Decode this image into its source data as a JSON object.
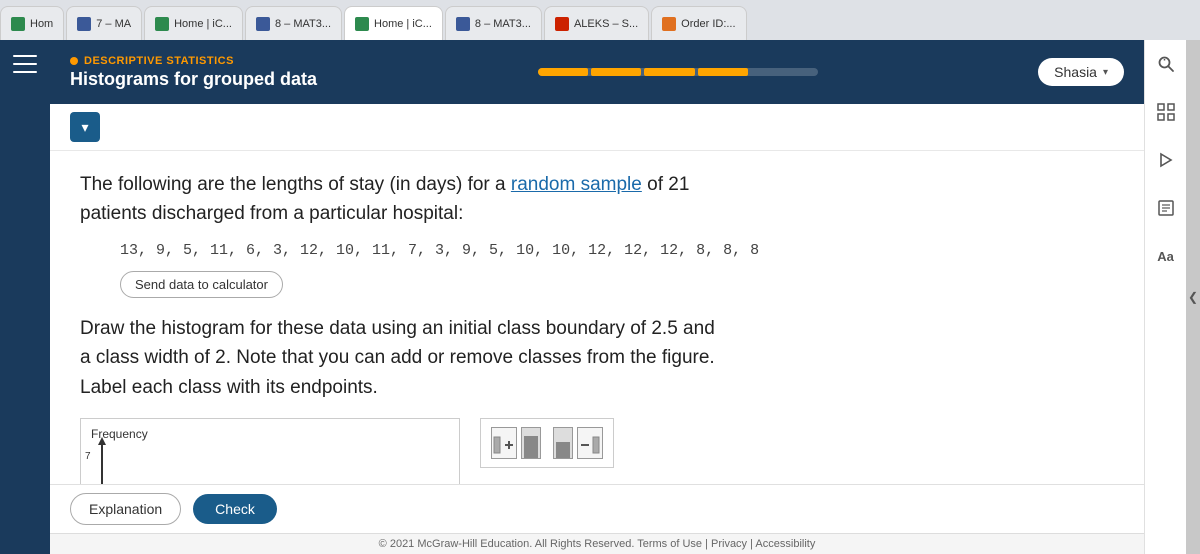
{
  "tabs": [
    {
      "id": "tab1",
      "label": "Hom",
      "icon": "green",
      "active": false
    },
    {
      "id": "tab2",
      "label": "7 – MA",
      "icon": "blue",
      "active": false
    },
    {
      "id": "tab3",
      "label": "Home | iC...",
      "icon": "green",
      "active": false
    },
    {
      "id": "tab4",
      "label": "8 – MAT3...",
      "icon": "blue",
      "active": false
    },
    {
      "id": "tab5",
      "label": "Home | iC...",
      "icon": "green",
      "active": true
    },
    {
      "id": "tab6",
      "label": "8 – MAT3...",
      "icon": "blue",
      "active": false
    },
    {
      "id": "tab7",
      "label": "ALEKS – S...",
      "icon": "red",
      "active": false
    },
    {
      "id": "tab8",
      "label": "Order ID:...",
      "icon": "orange",
      "active": false
    }
  ],
  "header": {
    "subtitle": "DESCRIPTIVE STATISTICS",
    "title": "Histograms for grouped data",
    "user": "Shasia"
  },
  "expand_btn": "▾",
  "problem": {
    "text1": "The following are the lengths of stay (in days) for a ",
    "link": "random sample",
    "text2": " of 21",
    "text3": "patients discharged from a particular hospital:",
    "data": "13, 9, 5, 11, 6, 3, 12, 10, 11, 7, 3, 9, 5, 10, 10, 12, 12, 12, 8, 8, 8",
    "send_btn": "Send data to calculator"
  },
  "instruction": {
    "text1": "Draw the ",
    "link": "histogram",
    "text2": " for these data using an initial class boundary of 2.5 and",
    "text3": "a class width of 2. Note that you can add or remove classes from the figure.",
    "text4": "Label each class with its endpoints."
  },
  "chart": {
    "y_label": "Frequency",
    "tick": "7"
  },
  "class_controls": {
    "add_col_left_label": "add column left",
    "remove_col_left_label": "remove column left",
    "add_col_right_label": "add column right",
    "remove_col_right_label": "remove column right"
  },
  "buttons": {
    "explanation": "Explanation",
    "check": "Check"
  },
  "footer": {
    "text": "© 2021 McGraw-Hill Education. All Rights Reserved.   Terms of Use  |  Privacy  |  Accessibility"
  },
  "right_tools": {
    "search": "🔍",
    "grid": "⊞",
    "play": "▶",
    "book": "📖",
    "font": "Aa"
  }
}
